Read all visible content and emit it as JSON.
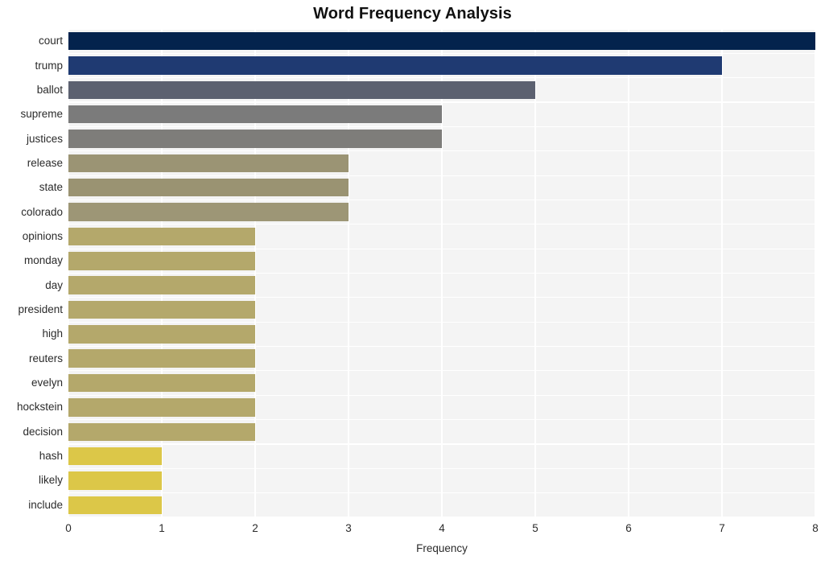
{
  "chart_data": {
    "type": "bar",
    "orientation": "horizontal",
    "title": "Word Frequency Analysis",
    "xlabel": "Frequency",
    "ylabel": "",
    "xlim": [
      0,
      8
    ],
    "xticks": [
      0,
      1,
      2,
      3,
      4,
      5,
      6,
      7,
      8
    ],
    "xtick_labels": [
      "0",
      "1",
      "2",
      "3",
      "4",
      "5",
      "6",
      "7",
      "8"
    ],
    "grid": true,
    "grid_color": "#ffffff",
    "plot_background": "#f4f4f4",
    "figure_background": "#ffffff",
    "legend": null,
    "categories": [
      "court",
      "trump",
      "ballot",
      "supreme",
      "justices",
      "release",
      "state",
      "colorado",
      "opinions",
      "monday",
      "day",
      "president",
      "high",
      "reuters",
      "evelyn",
      "hockstein",
      "decision",
      "hash",
      "likely",
      "include"
    ],
    "values": [
      8,
      7,
      5,
      4,
      4,
      3,
      3,
      3,
      2,
      2,
      2,
      2,
      2,
      2,
      2,
      2,
      2,
      1,
      1,
      1
    ],
    "bar_colors": [
      "#04234d",
      "#1f3a72",
      "#5c6170",
      "#7b7b7b",
      "#7e7d7a",
      "#9b9474",
      "#9a9372",
      "#9d9676",
      "#b4a86b",
      "#b4a86b",
      "#b4a86b",
      "#b4a86b",
      "#b4a86b",
      "#b4a86b",
      "#b4a86b",
      "#b4a86b",
      "#b4a86b",
      "#dcc748",
      "#dcc748",
      "#dcc748"
    ]
  }
}
